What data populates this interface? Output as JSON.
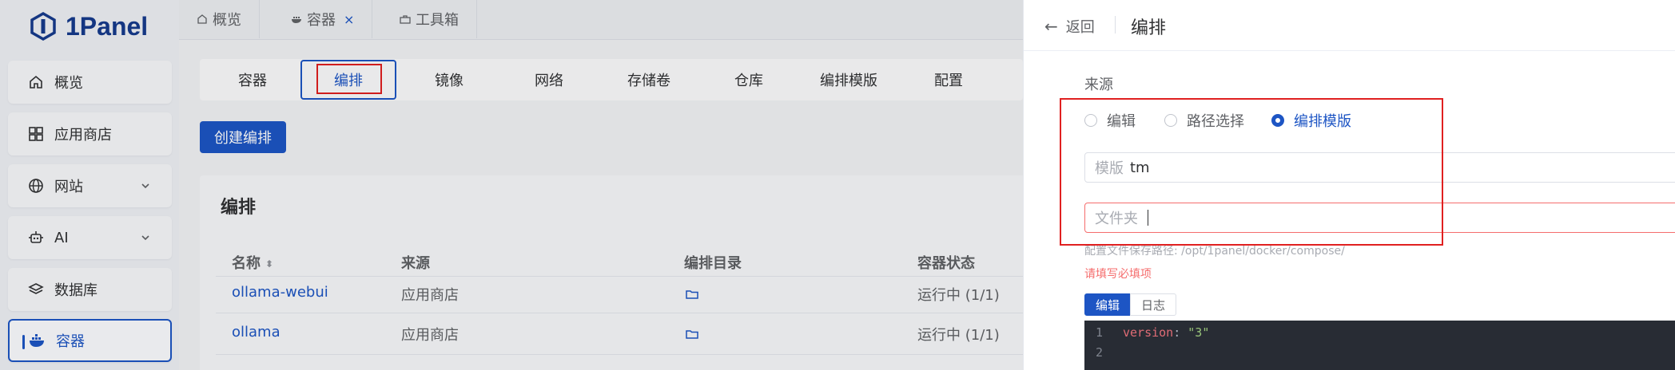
{
  "app": {
    "name": "1Panel",
    "brand_color": "#1d55c4"
  },
  "sidebar": {
    "items": [
      {
        "label": "概览",
        "icon": "home-icon",
        "expandable": false
      },
      {
        "label": "应用商店",
        "icon": "grid-icon",
        "expandable": false
      },
      {
        "label": "网站",
        "icon": "globe-icon",
        "expandable": true
      },
      {
        "label": "AI",
        "icon": "robot-icon",
        "expandable": true
      },
      {
        "label": "数据库",
        "icon": "layers-icon",
        "expandable": false
      },
      {
        "label": "容器",
        "icon": "docker-icon",
        "expandable": false,
        "active": true
      }
    ]
  },
  "tabs": [
    {
      "label": "概览",
      "icon": "home-icon"
    },
    {
      "label": "容器",
      "icon": "docker-icon",
      "closable": true,
      "close": "×"
    },
    {
      "label": "工具箱",
      "icon": "toolbox-icon"
    }
  ],
  "subnav": {
    "items": [
      "容器",
      "编排",
      "镜像",
      "网络",
      "存储卷",
      "仓库",
      "编排模版",
      "配置"
    ],
    "active": "编排"
  },
  "create_button": "创建编排",
  "panel": {
    "title": "编排",
    "columns": [
      "名称",
      "来源",
      "编排目录",
      "容器状态"
    ],
    "rows": [
      {
        "name": "ollama-webui",
        "source": "应用商店",
        "status": "运行中 (1/1)"
      },
      {
        "name": "ollama",
        "source": "应用商店",
        "status": "运行中 (1/1)"
      }
    ]
  },
  "drawer": {
    "back": "返回",
    "title": "编排",
    "source_label": "来源",
    "options": [
      {
        "label": "编辑",
        "checked": false
      },
      {
        "label": "路径选择",
        "checked": false
      },
      {
        "label": "编排模版",
        "checked": true
      }
    ],
    "template_field": {
      "prefix": "模版",
      "value": "tm"
    },
    "folder_field": {
      "prefix": "文件夹",
      "value": ""
    },
    "hint": "配置文件保存路径: /opt/1panel/docker/compose/",
    "error": "请填写必填项",
    "segments": [
      "编辑",
      "日志"
    ],
    "editor_lines": [
      {
        "n": "1",
        "key": "version",
        "value": "\"3\""
      },
      {
        "n": "2",
        "key": "",
        "value": ""
      }
    ]
  }
}
